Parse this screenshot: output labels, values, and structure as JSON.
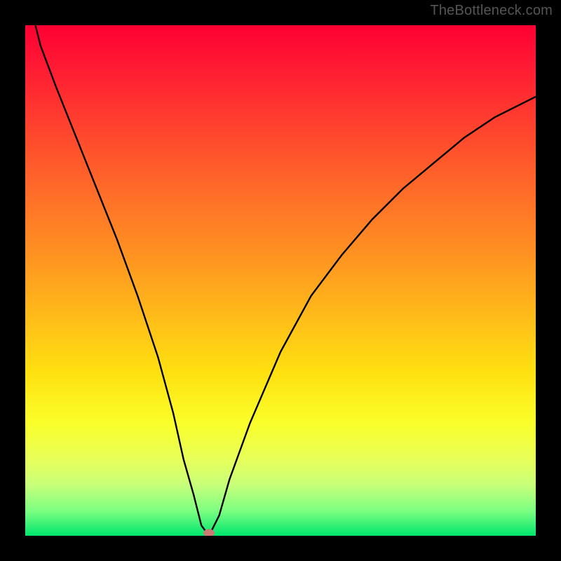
{
  "watermark": "TheBottleneck.com",
  "chart_data": {
    "type": "line",
    "title": "",
    "xlabel": "",
    "ylabel": "",
    "xlim": [
      0,
      100
    ],
    "ylim": [
      0,
      100
    ],
    "grid": false,
    "legend": false,
    "background": {
      "type": "vertical-gradient",
      "stops": [
        {
          "pos": 0,
          "color": "#ff0033"
        },
        {
          "pos": 18,
          "color": "#ff3c2f"
        },
        {
          "pos": 44,
          "color": "#ff8f22"
        },
        {
          "pos": 68,
          "color": "#ffe010"
        },
        {
          "pos": 85,
          "color": "#e8ff5a"
        },
        {
          "pos": 100,
          "color": "#00e66d"
        }
      ]
    },
    "series": [
      {
        "name": "bottleneck-curve",
        "color": "#000000",
        "x": [
          1,
          3,
          6,
          10,
          14,
          18,
          22,
          26,
          29,
          31,
          33,
          34.5,
          36,
          38,
          40,
          44,
          50,
          56,
          62,
          68,
          74,
          80,
          86,
          92,
          98,
          100
        ],
        "y": [
          104,
          96,
          88,
          78,
          68,
          58,
          47,
          35,
          24,
          15,
          8,
          2,
          0,
          4,
          11,
          22,
          36,
          47,
          55,
          62,
          68,
          73,
          78,
          82,
          85,
          86
        ]
      }
    ],
    "marker": {
      "name": "optimal-point",
      "shape": "ellipse",
      "color": "#cc7a74",
      "x": 36,
      "y": 0.5
    }
  }
}
